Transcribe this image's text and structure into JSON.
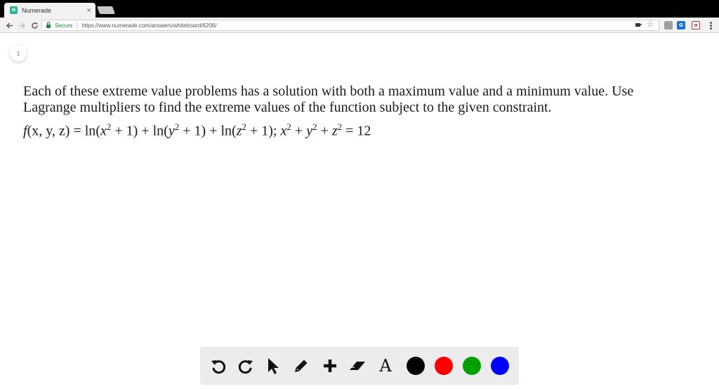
{
  "browser": {
    "tab_title": "Numerade",
    "tab_favicon_text": "N",
    "close_glyph": "×",
    "secure_label": "Secure",
    "url": "https://www.numerade.com/answers/whiteboard/6206/",
    "extensions": [
      "",
      "G",
      "ʊ"
    ]
  },
  "page": {
    "page_number": "1",
    "problem_line1": "Each of these extreme value problems has a solution with both a maximum value and a minimum value. Use",
    "problem_line2": "Lagrange multipliers to find the extreme values of the function subject to the given constraint.",
    "formula": {
      "f": "f",
      "args": "(x, y, z)",
      "eq": " = ",
      "ln": "ln",
      "open_x": "(",
      "x": "x",
      "two": "2",
      "plus_one": " + 1)",
      "plus": " + ",
      "y": "y",
      "z": "z",
      "semi": "; ",
      "equals_12": " = 12"
    }
  },
  "toolbar": {
    "text_tool_label": "A",
    "colors": [
      "#000000",
      "#ff0000",
      "#00a000",
      "#0000ff"
    ]
  },
  "icons": [
    "back-icon",
    "forward-icon",
    "reload-icon",
    "lock-icon",
    "camera-icon",
    "star-icon",
    "menu-icon",
    "undo-icon",
    "redo-icon",
    "pointer-icon",
    "pencil-icon",
    "plus-icon",
    "eraser-icon",
    "text-icon"
  ]
}
